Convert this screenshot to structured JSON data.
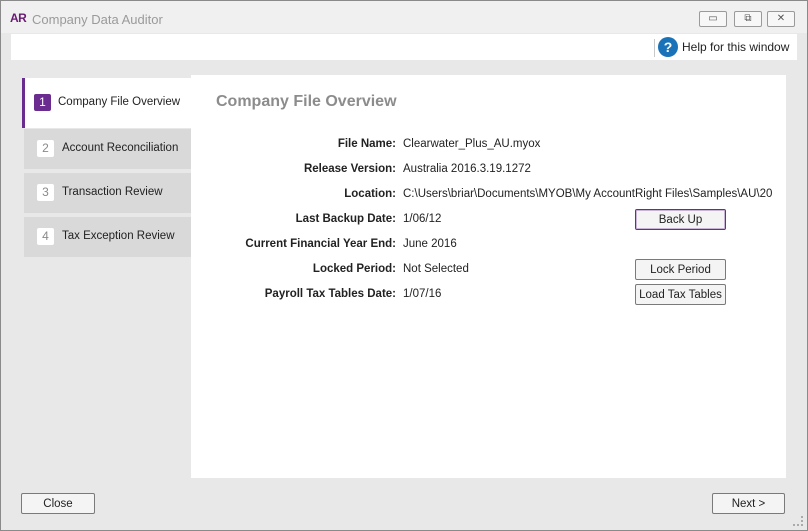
{
  "window": {
    "app_icon": "AR",
    "title": "Company Data Auditor",
    "controls": {
      "minimize": "▭",
      "restore": "⧉",
      "close": "✕"
    }
  },
  "help": {
    "icon": "?",
    "label": "Help for this window"
  },
  "steps": [
    {
      "num": "1",
      "label": "Company File Overview"
    },
    {
      "num": "2",
      "label": "Account Reconciliation"
    },
    {
      "num": "3",
      "label": "Transaction Review"
    },
    {
      "num": "4",
      "label": "Tax Exception Review"
    }
  ],
  "panel": {
    "title": "Company File Overview",
    "fields": [
      {
        "label": "File Name:",
        "value": "Clearwater_Plus_AU.myox"
      },
      {
        "label": "Release Version:",
        "value": "Australia 2016.3.19.1272"
      },
      {
        "label": "Location:",
        "value": "C:\\Users\\briar\\Documents\\MYOB\\My AccountRight Files\\Samples\\AU\\20"
      },
      {
        "label": "Last Backup Date:",
        "value": "1/06/12"
      },
      {
        "label": "Current Financial Year End:",
        "value": "June 2016"
      },
      {
        "label": "Locked Period:",
        "value": "Not Selected"
      },
      {
        "label": "Payroll Tax Tables Date:",
        "value": "1/07/16"
      }
    ],
    "buttons": {
      "back_up": "Back Up",
      "lock_period": "Lock Period",
      "load_tax_tables": "Load Tax Tables"
    }
  },
  "footer": {
    "close": "Close",
    "next": "Next >"
  },
  "colors": {
    "accent": "#6a2c8e",
    "help_icon": "#1a73b8"
  }
}
